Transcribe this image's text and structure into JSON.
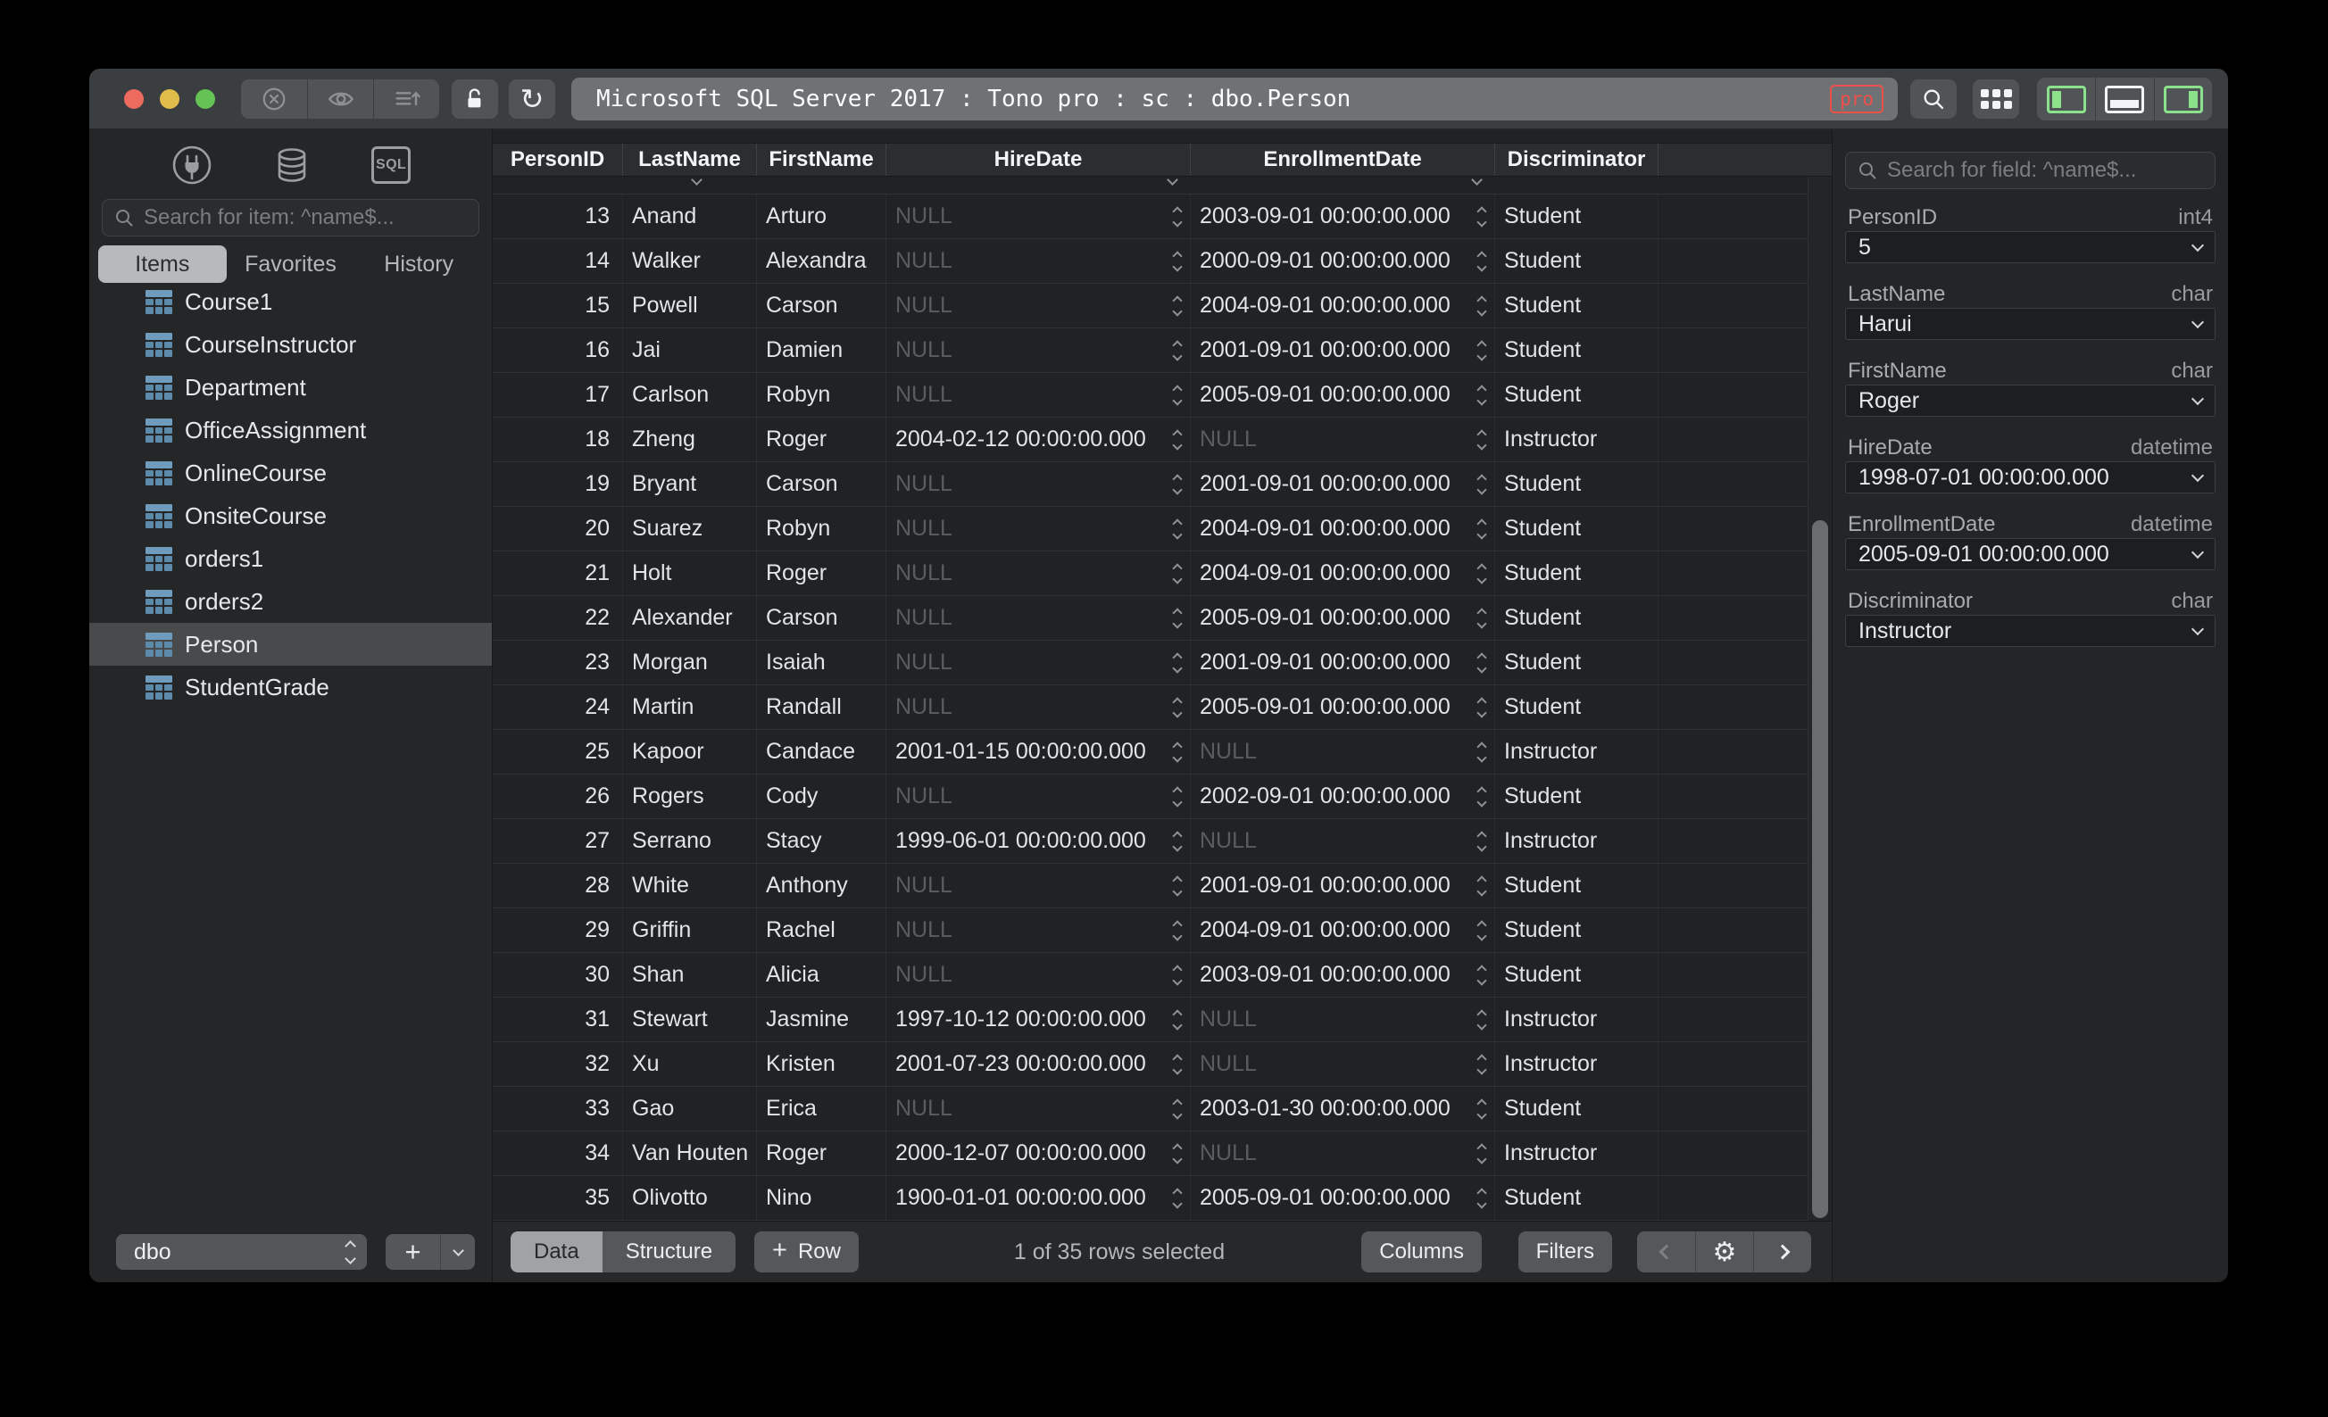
{
  "window": {
    "title": "Microsoft SQL Server 2017 : Tono pro : sc : dbo.Person",
    "pro_badge": "pro"
  },
  "icons": {
    "refresh": "↻",
    "gear": "⚙",
    "plus": "+",
    "sql_badge": "SQL"
  },
  "sidebar": {
    "search_placeholder": "Search for item: ^name$...",
    "tabs": [
      "Items",
      "Favorites",
      "History"
    ],
    "active_tab": "Items",
    "tables": [
      "Course1",
      "CourseInstructor",
      "Department",
      "OfficeAssignment",
      "OnlineCourse",
      "OnsiteCourse",
      "orders1",
      "orders2",
      "Person",
      "StudentGrade"
    ],
    "selected_table": "Person",
    "schema_select": "dbo"
  },
  "grid": {
    "columns": [
      "PersonID",
      "LastName",
      "FirstName",
      "HireDate",
      "EnrollmentDate",
      "Discriminator"
    ],
    "null_text": "NULL",
    "rows": [
      {
        "person_id": 13,
        "last_name": "Anand",
        "first_name": "Arturo",
        "hire_date": null,
        "enrollment_date": "2003-09-01 00:00:00.000",
        "discriminator": "Student"
      },
      {
        "person_id": 14,
        "last_name": "Walker",
        "first_name": "Alexandra",
        "hire_date": null,
        "enrollment_date": "2000-09-01 00:00:00.000",
        "discriminator": "Student"
      },
      {
        "person_id": 15,
        "last_name": "Powell",
        "first_name": "Carson",
        "hire_date": null,
        "enrollment_date": "2004-09-01 00:00:00.000",
        "discriminator": "Student"
      },
      {
        "person_id": 16,
        "last_name": "Jai",
        "first_name": "Damien",
        "hire_date": null,
        "enrollment_date": "2001-09-01 00:00:00.000",
        "discriminator": "Student"
      },
      {
        "person_id": 17,
        "last_name": "Carlson",
        "first_name": "Robyn",
        "hire_date": null,
        "enrollment_date": "2005-09-01 00:00:00.000",
        "discriminator": "Student"
      },
      {
        "person_id": 18,
        "last_name": "Zheng",
        "first_name": "Roger",
        "hire_date": "2004-02-12 00:00:00.000",
        "enrollment_date": null,
        "discriminator": "Instructor"
      },
      {
        "person_id": 19,
        "last_name": "Bryant",
        "first_name": "Carson",
        "hire_date": null,
        "enrollment_date": "2001-09-01 00:00:00.000",
        "discriminator": "Student"
      },
      {
        "person_id": 20,
        "last_name": "Suarez",
        "first_name": "Robyn",
        "hire_date": null,
        "enrollment_date": "2004-09-01 00:00:00.000",
        "discriminator": "Student"
      },
      {
        "person_id": 21,
        "last_name": "Holt",
        "first_name": "Roger",
        "hire_date": null,
        "enrollment_date": "2004-09-01 00:00:00.000",
        "discriminator": "Student"
      },
      {
        "person_id": 22,
        "last_name": "Alexander",
        "first_name": "Carson",
        "hire_date": null,
        "enrollment_date": "2005-09-01 00:00:00.000",
        "discriminator": "Student"
      },
      {
        "person_id": 23,
        "last_name": "Morgan",
        "first_name": "Isaiah",
        "hire_date": null,
        "enrollment_date": "2001-09-01 00:00:00.000",
        "discriminator": "Student"
      },
      {
        "person_id": 24,
        "last_name": "Martin",
        "first_name": "Randall",
        "hire_date": null,
        "enrollment_date": "2005-09-01 00:00:00.000",
        "discriminator": "Student"
      },
      {
        "person_id": 25,
        "last_name": "Kapoor",
        "first_name": "Candace",
        "hire_date": "2001-01-15 00:00:00.000",
        "enrollment_date": null,
        "discriminator": "Instructor"
      },
      {
        "person_id": 26,
        "last_name": "Rogers",
        "first_name": "Cody",
        "hire_date": null,
        "enrollment_date": "2002-09-01 00:00:00.000",
        "discriminator": "Student"
      },
      {
        "person_id": 27,
        "last_name": "Serrano",
        "first_name": "Stacy",
        "hire_date": "1999-06-01 00:00:00.000",
        "enrollment_date": null,
        "discriminator": "Instructor"
      },
      {
        "person_id": 28,
        "last_name": "White",
        "first_name": "Anthony",
        "hire_date": null,
        "enrollment_date": "2001-09-01 00:00:00.000",
        "discriminator": "Student"
      },
      {
        "person_id": 29,
        "last_name": "Griffin",
        "first_name": "Rachel",
        "hire_date": null,
        "enrollment_date": "2004-09-01 00:00:00.000",
        "discriminator": "Student"
      },
      {
        "person_id": 30,
        "last_name": "Shan",
        "first_name": "Alicia",
        "hire_date": null,
        "enrollment_date": "2003-09-01 00:00:00.000",
        "discriminator": "Student"
      },
      {
        "person_id": 31,
        "last_name": "Stewart",
        "first_name": "Jasmine",
        "hire_date": "1997-10-12 00:00:00.000",
        "enrollment_date": null,
        "discriminator": "Instructor"
      },
      {
        "person_id": 32,
        "last_name": "Xu",
        "first_name": "Kristen",
        "hire_date": "2001-07-23 00:00:00.000",
        "enrollment_date": null,
        "discriminator": "Instructor"
      },
      {
        "person_id": 33,
        "last_name": "Gao",
        "first_name": "Erica",
        "hire_date": null,
        "enrollment_date": "2003-01-30 00:00:00.000",
        "discriminator": "Student"
      },
      {
        "person_id": 34,
        "last_name": "Van Houten",
        "first_name": "Roger",
        "hire_date": "2000-12-07 00:00:00.000",
        "enrollment_date": null,
        "discriminator": "Instructor"
      },
      {
        "person_id": 35,
        "last_name": "Olivotto",
        "first_name": "Nino",
        "hire_date": "1900-01-01 00:00:00.000",
        "enrollment_date": "2005-09-01 00:00:00.000",
        "discriminator": "Student"
      }
    ]
  },
  "statusbar": {
    "tabs": [
      "Data",
      "Structure"
    ],
    "active_tab": "Data",
    "add_row_label": "Row",
    "selection_text": "1 of 35 rows selected",
    "columns_label": "Columns",
    "filters_label": "Filters"
  },
  "inspector": {
    "search_placeholder": "Search for field: ^name$...",
    "fields": [
      {
        "name": "PersonID",
        "type": "int4",
        "value": "5"
      },
      {
        "name": "LastName",
        "type": "char",
        "value": "Harui"
      },
      {
        "name": "FirstName",
        "type": "char",
        "value": "Roger"
      },
      {
        "name": "HireDate",
        "type": "datetime",
        "value": "1998-07-01 00:00:00.000"
      },
      {
        "name": "EnrollmentDate",
        "type": "datetime",
        "value": "2005-09-01 00:00:00.000"
      },
      {
        "name": "Discriminator",
        "type": "char",
        "value": "Instructor"
      }
    ]
  },
  "colors": {
    "accent_green": "#8ce28a",
    "pro_red": "#ef4f49",
    "table_icon_blue": "#5d8aab",
    "window_chrome": "#3b3e40",
    "row_background": "#202224",
    "null_gray": "#5a5d60"
  }
}
